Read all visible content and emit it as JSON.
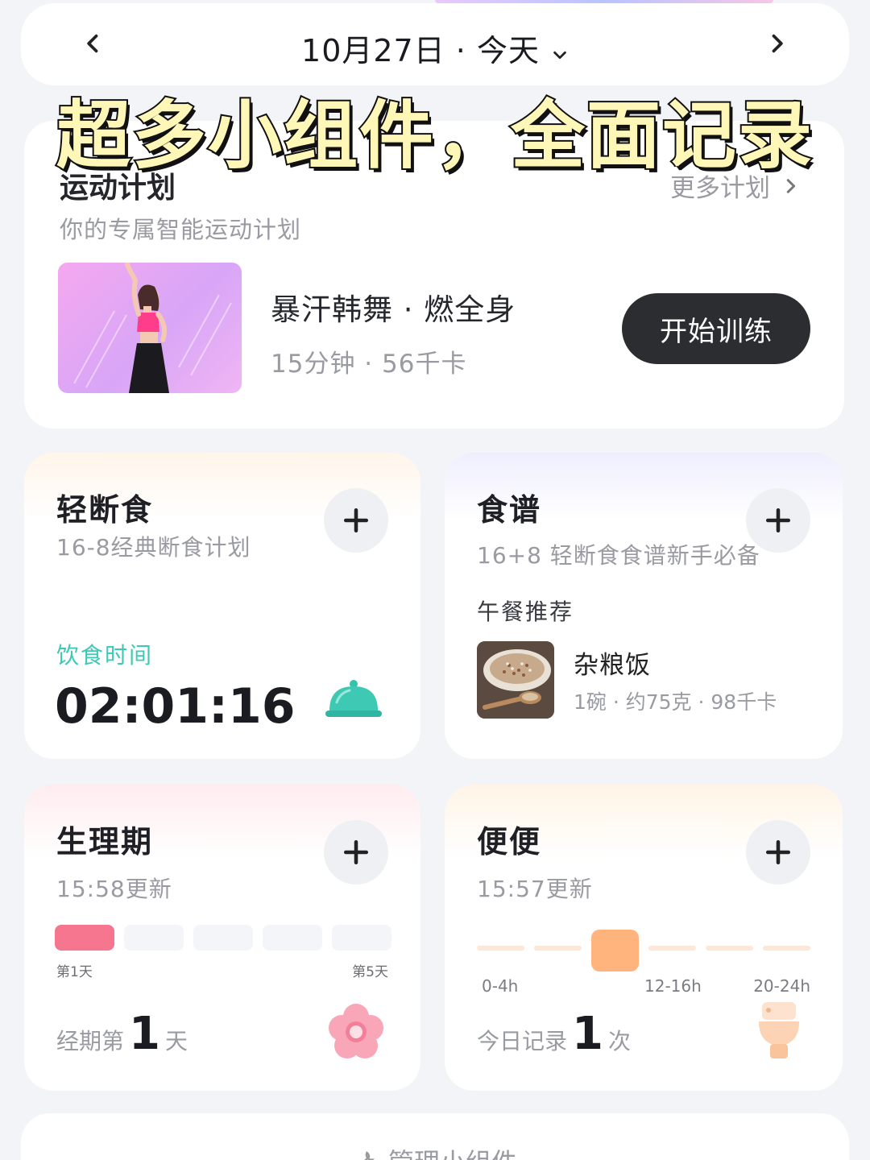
{
  "header": {
    "date_label": "10月27日 · 今天",
    "prev_icon": "chevron-left-icon",
    "next_icon": "chevron-right-icon"
  },
  "overlay_caption": "超多小组件，全面记录",
  "plan": {
    "title": "运动计划",
    "more_label": "更多计划",
    "subtitle": "你的专属智能运动计划",
    "workout_name": "暴汗韩舞 · 燃全身",
    "workout_meta": "15分钟 · 56千卡",
    "start_label": "开始训练"
  },
  "fasting": {
    "title": "轻断食",
    "subtitle": "16-8经典断食计划",
    "status_label": "饮食时间",
    "timer": "02:01:16",
    "accent": "#3ec9b5"
  },
  "recipe": {
    "title": "食谱",
    "subtitle": "16+8 轻断食食谱新手必备",
    "section_label": "午餐推荐",
    "food_name": "杂粮饭",
    "food_meta": "1碗 · 约75克 · 98千卡"
  },
  "period": {
    "title": "生理期",
    "updated": "15:58更新",
    "first_day_label": "第1天",
    "last_day_label": "第5天",
    "active_day": 1,
    "total_days": 5,
    "summary_prefix": "经期第",
    "summary_value": "1",
    "summary_suffix": "天",
    "accent": "#f7768f"
  },
  "poop": {
    "title": "便便",
    "updated": "15:57更新",
    "hour_labels": [
      "0-4h",
      "12-16h",
      "20-24h"
    ],
    "active_slot": 3,
    "total_slots": 6,
    "summary_prefix": "今日记录",
    "summary_value": "1",
    "summary_suffix": "次",
    "accent": "#ffb47d"
  },
  "manage": {
    "label": "管理小组件"
  }
}
